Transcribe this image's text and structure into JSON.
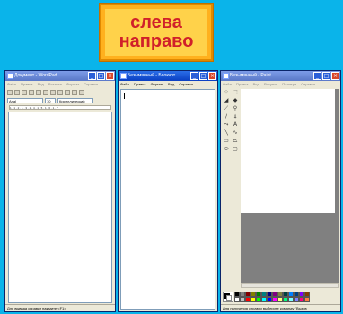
{
  "banner": {
    "line1": "слева",
    "line2": "направо"
  },
  "wordpad": {
    "title": "Документ - WordPad",
    "menu": [
      "Файл",
      "Правка",
      "Вид",
      "Вставка",
      "Формат",
      "Справка"
    ],
    "font": "Arial",
    "size": "10",
    "script": "Кириллический",
    "ruler": "1 · 1 · 2 · 1 · 3 · 1 · 4 · 1 · 5 · 1 · 6 · 1 · 7",
    "status": "Для вывода справки нажмите <F1>"
  },
  "notepad": {
    "title": "Безымянный - Блокнот",
    "menu": [
      "Файл",
      "Правка",
      "Формат",
      "Вид",
      "Справка"
    ]
  },
  "paint": {
    "title": "Безымянный - Paint",
    "menu": [
      "Файл",
      "Правка",
      "Вид",
      "Рисунок",
      "Палитра",
      "Справка"
    ],
    "status": "Для получения справки выберите команду \"Вызов",
    "colors": [
      "#000000",
      "#808080",
      "#800000",
      "#808000",
      "#008000",
      "#008080",
      "#000080",
      "#800080",
      "#808040",
      "#004040",
      "#0080ff",
      "#004080",
      "#8000ff",
      "#804000",
      "#ffffff",
      "#c0c0c0",
      "#ff0000",
      "#ffff00",
      "#00ff00",
      "#00ffff",
      "#0000ff",
      "#ff00ff",
      "#ffff80",
      "#00ff80",
      "#80ffff",
      "#8080ff",
      "#ff0080",
      "#ff8040"
    ]
  },
  "window_controls": {
    "minimize": "_",
    "maximize": "□",
    "close": "×"
  }
}
